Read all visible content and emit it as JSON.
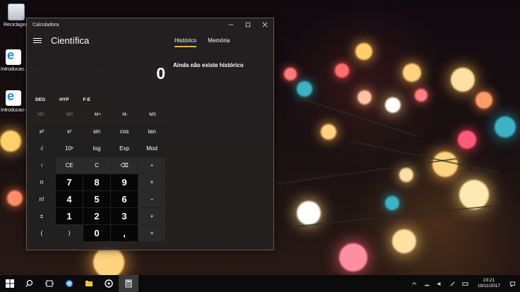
{
  "desktop": {
    "icons": [
      {
        "label": "Reciclagem"
      },
      {
        "label": "Introducao..."
      },
      {
        "label": "Introducao-(1)"
      }
    ]
  },
  "calculator": {
    "title": "Calculadora",
    "mode": "Científica",
    "display": "0",
    "tabs": [
      {
        "label": "Histórico"
      },
      {
        "label": "Memória"
      }
    ],
    "history_empty": "Ainda não existe histórico",
    "angle_modes": [
      "DEG",
      "HYP",
      "F-E"
    ],
    "memory": [
      "MC",
      "MR",
      "M+",
      "M-",
      "MS"
    ],
    "keys": {
      "r1": [
        "x²",
        "xʸ",
        "sin",
        "cos",
        "tan"
      ],
      "r2": [
        "√",
        "10ˣ",
        "log",
        "Exp",
        "Mod"
      ],
      "r3": [
        "↑",
        "CE",
        "C",
        "⌫",
        "÷"
      ],
      "r4": [
        "π",
        "7",
        "8",
        "9",
        "×"
      ],
      "r5": [
        "n!",
        "4",
        "5",
        "6",
        "−"
      ],
      "r6": [
        "±",
        "1",
        "2",
        "3",
        "+"
      ],
      "r7": [
        "(",
        ")",
        "0",
        ",",
        "="
      ]
    }
  },
  "taskbar": {
    "time": "23:21",
    "date": "18/11/2017",
    "icons": [
      "windows-icon",
      "search-icon",
      "task-view-icon",
      "edge-icon",
      "file-explorer-icon",
      "media-icon",
      "calculator-icon"
    ]
  }
}
